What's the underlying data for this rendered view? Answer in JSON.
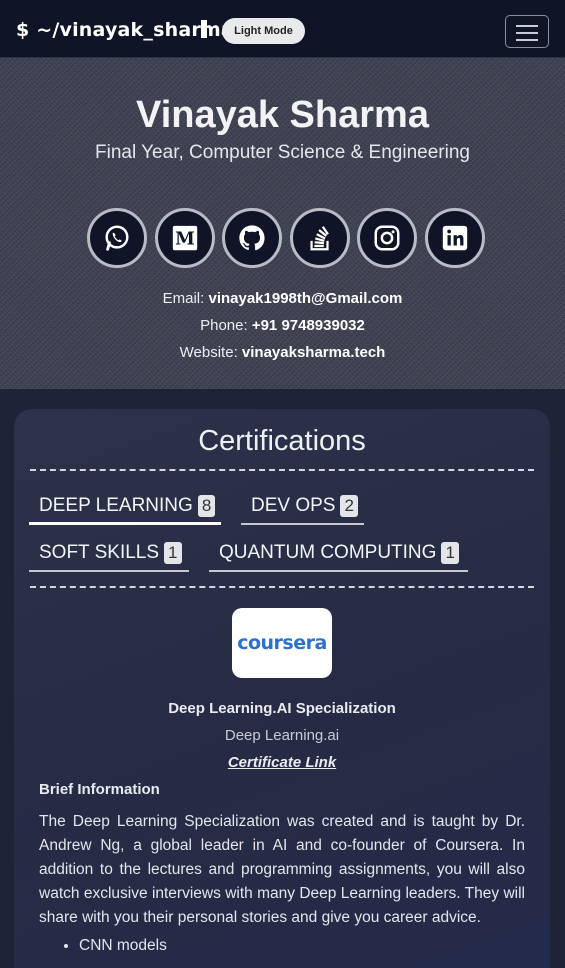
{
  "navbar": {
    "brand": "$ ~/vinayak_sharma",
    "mode_button": "Light Mode"
  },
  "hero": {
    "name": "Vinayak Sharma",
    "subtitle": "Final Year, Computer Science & Engineering",
    "social_icons": [
      "whatsapp-icon",
      "medium-icon",
      "github-icon",
      "stackoverflow-icon",
      "instagram-icon",
      "linkedin-icon"
    ],
    "email_label": "Email:",
    "email": "vinayak1998th@Gmail.com",
    "phone_label": "Phone:",
    "phone": "+91 9748939032",
    "website_label": "Website:",
    "website": "vinayaksharma.tech"
  },
  "certifications": {
    "title": "Certifications",
    "tabs": [
      {
        "label": "DEEP LEARNING",
        "count": "8",
        "active": true
      },
      {
        "label": "DEV OPS",
        "count": "2",
        "active": false
      },
      {
        "label": "SOFT SKILLS",
        "count": "1",
        "active": false
      },
      {
        "label": "QUANTUM COMPUTING",
        "count": "1",
        "active": false
      }
    ],
    "current": {
      "logo_text": "coursera",
      "name": "Deep Learning.AI Specialization",
      "org": "Deep Learning.ai",
      "link": "Certificate Link",
      "brief_title": "Brief Information",
      "brief_text": "The Deep Learning Specialization was created and is taught by Dr. Andrew Ng, a global leader in AI and co-founder of Coursera. In addition to the lectures and programming assignments, you will also watch exclusive interviews with many Deep Learning leaders. They will share with you their personal stories and give you career advice.",
      "bullets": [
        "CNN models"
      ]
    }
  },
  "colors": {
    "navbar_bg": "#0f1427",
    "card_bg": "#2c3249",
    "accent_logo": "#2a73cc"
  }
}
